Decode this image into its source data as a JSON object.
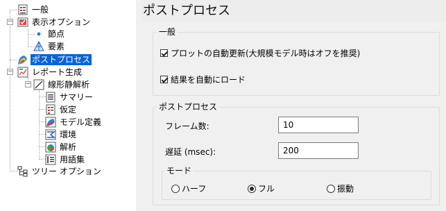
{
  "tree": {
    "items": [
      {
        "label": "一般"
      },
      {
        "label": "表示オプション"
      },
      {
        "label": "節点"
      },
      {
        "label": "要素"
      },
      {
        "label": "ポストプロセス"
      },
      {
        "label": "レポート生成"
      },
      {
        "label": "線形静解析"
      },
      {
        "label": "サマリー"
      },
      {
        "label": "仮定"
      },
      {
        "label": "モデル定義"
      },
      {
        "label": "環境"
      },
      {
        "label": "解析"
      },
      {
        "label": "用語集"
      },
      {
        "label": "ツリー オプション"
      }
    ],
    "selected": "ポストプロセス"
  },
  "panel": {
    "title": "ポストプロセス",
    "general": {
      "title": "一般",
      "auto_update_label": "プロットの自動更新(大規模モデル時はオフを推奨)",
      "auto_update_checked": true,
      "auto_load_label": "結果を自動にロード",
      "auto_load_checked": true
    },
    "postprocess": {
      "title": "ポストプロセス",
      "frames_label": "フレーム数:",
      "frames_value": "10",
      "delay_label": "遅延 (msec):",
      "delay_value": "200",
      "mode": {
        "title": "モード",
        "options": [
          "ハーフ",
          "フル",
          "振動"
        ],
        "selected": "フル"
      }
    }
  },
  "colors": {
    "selection": "#0a64d8",
    "panel_bg": "#f0f0f0"
  }
}
